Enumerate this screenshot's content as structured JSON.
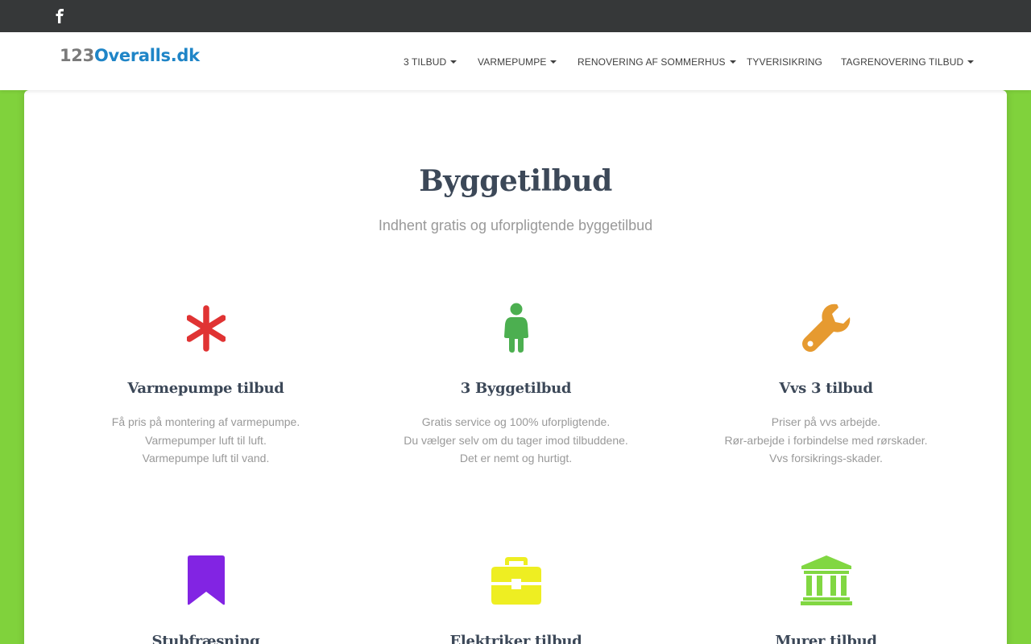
{
  "topbar": {
    "social": "facebook-icon"
  },
  "brand": {
    "prefix": "123",
    "name": "Overalls.dk"
  },
  "nav": {
    "items": [
      {
        "label": "3 TILBUD",
        "dropdown": true
      },
      {
        "label": "VARMEPUMPE",
        "dropdown": true
      },
      {
        "label": "RENOVERING AF SOMMERHUS",
        "dropdown": true
      },
      {
        "label": "TYVERISIKRING",
        "dropdown": false
      },
      {
        "label": "TAGRENOVERING TILBUD",
        "dropdown": true
      }
    ]
  },
  "hero": {
    "title": "Byggetilbud",
    "subtitle": "Indhent gratis og uforpligtende byggetilbud"
  },
  "features": [
    {
      "icon": "asterisk-icon",
      "color": "#e03333",
      "title": "Varmepumpe tilbud",
      "lines": [
        "Få pris på montering af varmepumpe.",
        "Varmepumper luft til luft.",
        "Varmepumpe luft til vand."
      ]
    },
    {
      "icon": "child-icon",
      "color": "#4caf50",
      "title": "3 Byggetilbud",
      "lines": [
        "Gratis service og 100% uforpligtende.",
        "Du vælger selv om du tager imod tilbuddene.",
        "Det er nemt og hurtigt."
      ]
    },
    {
      "icon": "wrench-icon",
      "color": "#e69a30",
      "title": "Vvs 3 tilbud",
      "lines": [
        "Priser på vvs arbejde.",
        "Rør-arbejde i forbindelse med rørskader.",
        "Vvs forsikrings-skader."
      ]
    },
    {
      "icon": "bookmark-icon",
      "color": "#8224e3",
      "title": "Stubfræsning",
      "lines": []
    },
    {
      "icon": "briefcase-icon",
      "color": "#eeee22",
      "title": "Elektriker tilbud",
      "lines": []
    },
    {
      "icon": "bank-icon",
      "color": "#81d742",
      "title": "Murer tilbud",
      "lines": []
    }
  ],
  "colors": {
    "page_bg": "#80d23c",
    "topbar_bg": "#363839",
    "brand_blue": "#1f85c7"
  }
}
